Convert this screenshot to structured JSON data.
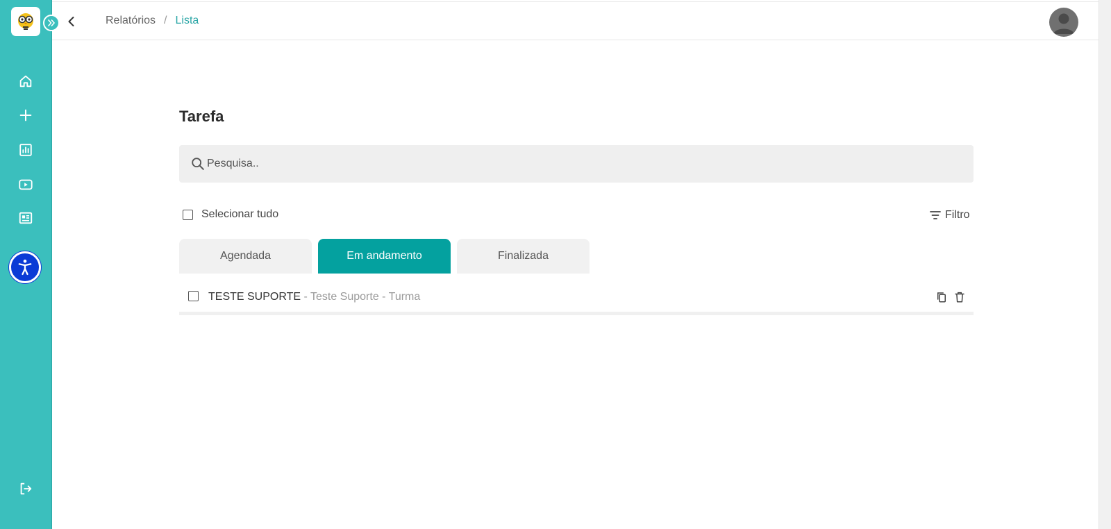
{
  "sidebar": {
    "logo_icon": "owl-with-glasses-logo",
    "expand_icon": "double-chevron-right-icon",
    "items": [
      {
        "name": "home",
        "icon": "home-icon"
      },
      {
        "name": "add",
        "icon": "plus-icon"
      },
      {
        "name": "reports",
        "icon": "bar-chart-icon"
      },
      {
        "name": "videos",
        "icon": "play-icon"
      },
      {
        "name": "news",
        "icon": "news-icon"
      }
    ],
    "accessibility_icon": "accessibility-icon",
    "logout_icon": "logout-icon",
    "color": "#3bbfbd"
  },
  "topbar": {
    "back_icon": "chevron-left-icon",
    "breadcrumb": {
      "parent": "Relatórios",
      "separator": "/",
      "current": "Lista"
    },
    "avatar_icon": "user-avatar-icon"
  },
  "main": {
    "title": "Tarefa",
    "search": {
      "placeholder": "Pesquisa..",
      "value": ""
    },
    "select_all_label": "Selecionar tudo",
    "filter_label": "Filtro",
    "tabs": [
      {
        "label": "Agendada",
        "active": false
      },
      {
        "label": "Em andamento",
        "active": true
      },
      {
        "label": "Finalizada",
        "active": false
      }
    ],
    "items": [
      {
        "title": "TESTE SUPORTE",
        "subtitle": " - Teste Suporte - Turma",
        "checked": false
      }
    ]
  },
  "colors": {
    "accent": "#04a19f",
    "sidebar": "#3bbfbd",
    "breadcrumb_active": "#2aa6a6",
    "accessibility": "#0b3bd6"
  }
}
